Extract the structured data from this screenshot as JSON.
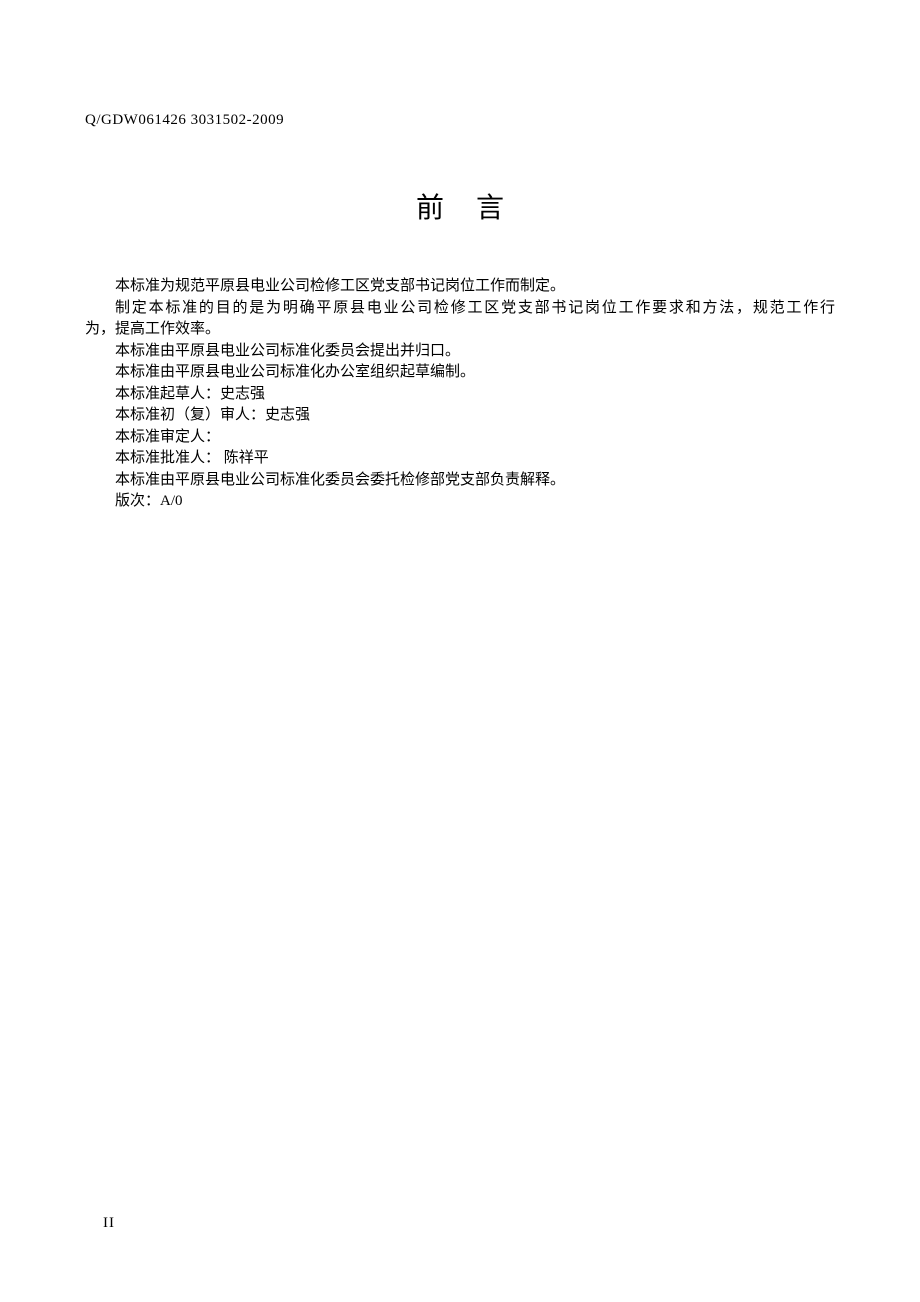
{
  "header": {
    "code": "Q/GDW061426 3031502-2009"
  },
  "title": "前言",
  "paragraphs": {
    "p1": "本标准为规范平原县电业公司检修工区党支部书记岗位工作而制定。",
    "p2a": "制定本标准的目的是为明确平原县电业公司检修工区党支部书记岗位工作要求和方法，规范工作行",
    "p2b": "为，提高工作效率。",
    "p3": "本标准由平原县电业公司标准化委员会提出并归口。",
    "p4": "本标准由平原县电业公司标准化办公室组织起草编制。",
    "p5": "本标准起草人：史志强",
    "p6": "本标准初（复）审人：史志强",
    "p7": "本标准审定人：",
    "p8": "本标准批准人： 陈祥平",
    "p9": "本标准由平原县电业公司标准化委员会委托检修部党支部负责解释。",
    "p10": "版次：A/0"
  },
  "footer": {
    "pageNumber": "II"
  }
}
